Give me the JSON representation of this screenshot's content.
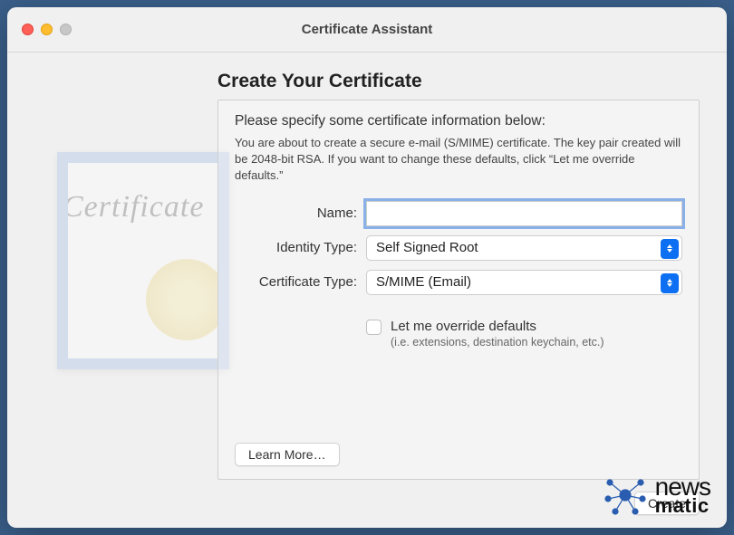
{
  "window": {
    "title": "Certificate Assistant"
  },
  "heading": "Create Your Certificate",
  "instructions": {
    "title": "Please specify some certificate information below:",
    "subtitle": "You are about to create a secure e-mail (S/MIME) certificate. The key pair created will be 2048-bit RSA. If you want to change these defaults, click “Let me override defaults.”"
  },
  "form": {
    "name_label": "Name:",
    "name_value": "",
    "identity_label": "Identity Type:",
    "identity_value": "Self Signed Root",
    "cert_type_label": "Certificate Type:",
    "cert_type_value": "S/MIME (Email)",
    "override_label": "Let me override defaults",
    "override_sub": "(i.e. extensions, destination keychain, etc.)",
    "override_checked": false
  },
  "buttons": {
    "learn_more": "Learn More…",
    "create": "Create"
  },
  "watermark": {
    "line1": "news",
    "line2": "matic"
  }
}
